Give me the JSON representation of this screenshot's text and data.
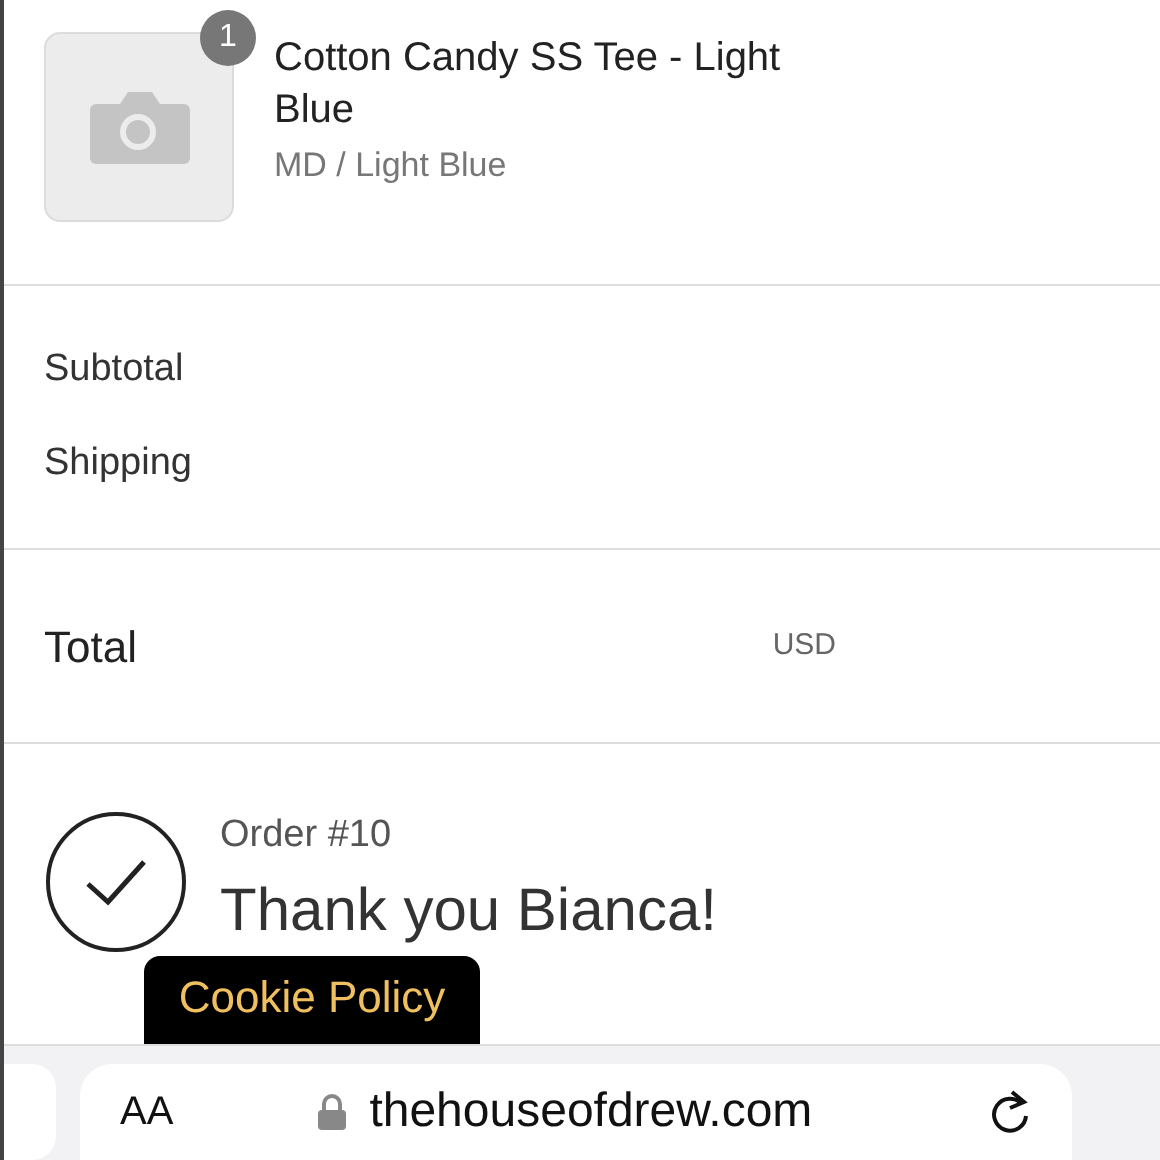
{
  "product": {
    "quantity": "1",
    "name": "Cotton Candy SS Tee - Light Blue",
    "variant": "MD / Light Blue"
  },
  "summary": [
    {
      "label": "Subtotal"
    },
    {
      "label": "Shipping"
    }
  ],
  "total": {
    "label": "Total",
    "currency": "USD"
  },
  "confirmation": {
    "order": "Order #10",
    "message": "Thank you Bianca!"
  },
  "cookie_banner": {
    "label": "Cookie Policy"
  },
  "browser_bar": {
    "text_size": "AA",
    "url": "thehouseofdrew.com"
  }
}
